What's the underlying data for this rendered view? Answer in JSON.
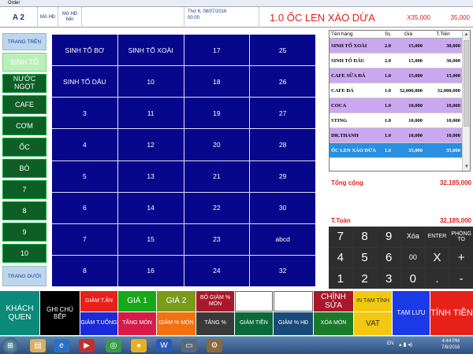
{
  "window": {
    "title": "Order"
  },
  "header": {
    "table": "A 2",
    "mo_hd": "Mở HĐ",
    "mo_hd_ben": "Mở HĐ bến",
    "datetime_line1": "Thứ 6, 08/07/2016",
    "datetime_line2": "00:00",
    "selected_item": "1.0 ỐC LEN XÀO DỪA",
    "unit_price": "X35,000",
    "line_total": "35,000"
  },
  "sidebar": {
    "up": "TRANG TRÊN",
    "down": "TRANG DƯỚI",
    "items": [
      "SINH TỐ",
      "NƯỚC NGỌT",
      "CAFE",
      "CƠM",
      "ỐC",
      "BÒ",
      "7",
      "8",
      "9",
      "10"
    ]
  },
  "menu_grid": [
    "SINH TỐ BƠ",
    "SINH TỐ XOÀI",
    "17",
    "25",
    "SINH TỐ DÂU",
    "10",
    "18",
    "26",
    "3",
    "11",
    "19",
    "27",
    "4",
    "12",
    "20",
    "28",
    "5",
    "13",
    "21",
    "29",
    "6",
    "14",
    "22",
    "30",
    "7",
    "15",
    "23",
    "abcd",
    "8",
    "16",
    "24",
    "32"
  ],
  "order": {
    "columns": [
      "Tên hàng",
      "SL",
      "Giá",
      "T.Tiền"
    ],
    "rows": [
      {
        "name": "SINH TỐ XOÀI",
        "qty": "2.0",
        "price": "15,000",
        "total": "30,000",
        "color": "#c9a8f0"
      },
      {
        "name": "SINH TỐ DÂU",
        "qty": "2.0",
        "price": "15,000",
        "total": "30,000",
        "color": "#ffffff"
      },
      {
        "name": "CAFE SỮA ĐÁ",
        "qty": "1.0",
        "price": "15,000",
        "total": "15,000",
        "color": "#c9a8f0"
      },
      {
        "name": "CAFE ĐÁ",
        "qty": "1.0",
        "price": "32,000,000",
        "total": "32,000,000",
        "color": "#ffffff"
      },
      {
        "name": "COCA",
        "qty": "1.0",
        "price": "10,000",
        "total": "10,000",
        "color": "#c9a8f0"
      },
      {
        "name": "STING",
        "qty": "1.0",
        "price": "10,000",
        "total": "10,000",
        "color": "#ffffff"
      },
      {
        "name": "DR.THANH",
        "qty": "1.0",
        "price": "10,000",
        "total": "10,000",
        "color": "#c9a8f0"
      },
      {
        "name": "ỐC LEN XÀO DỪA",
        "qty": "1.0",
        "price": "35,000",
        "total": "35,000",
        "color": "#2a8fe0"
      }
    ],
    "tong_cong_label": "Tổng cộng",
    "tong_cong": "32,185,000",
    "t_toan_label": "T.Toàn",
    "t_toan": "32,185,000"
  },
  "keypad": [
    "7",
    "8",
    "9",
    "Xóa",
    "ENTER",
    "PHÒNG TO",
    "4",
    "5",
    "6",
    "00",
    "X",
    "+",
    "1",
    "2",
    "3",
    "0",
    ".",
    "-"
  ],
  "functions": {
    "khach_quen": "KHÁCH QUEN",
    "ghi_chu_bep": "GHI CHÚ BẾP",
    "giam_t_an": "GIẢM T.ĂN",
    "giam_t_uong": "GIẢM T.UỐNG",
    "gia1": "GIÁ 1",
    "tang_mon": "TĂNG MÓN",
    "gia2": "GIÁ 2",
    "giam_pct_mon": "GIẢM % MÓN",
    "bo_giam_pct_mon": "BỎ GIẢM % MÓN",
    "tang_pct": "TĂNG %",
    "giam_tien": "GIẢM TIỀN",
    "giam_pct_hd": "GIẢM % HĐ",
    "chinh_sua": "CHỈNH SỬA",
    "xoa_mon": "XÓA MÓN",
    "in_tam_tinh": "IN TẠM TÍNH",
    "vat": "VAT",
    "tam_luu": "TẠM LƯU",
    "tinh_tien": "TÍNH TIỀN"
  },
  "taskbar": {
    "lang": "EN",
    "time": "4:44 PM",
    "date": "7/8/2016"
  }
}
